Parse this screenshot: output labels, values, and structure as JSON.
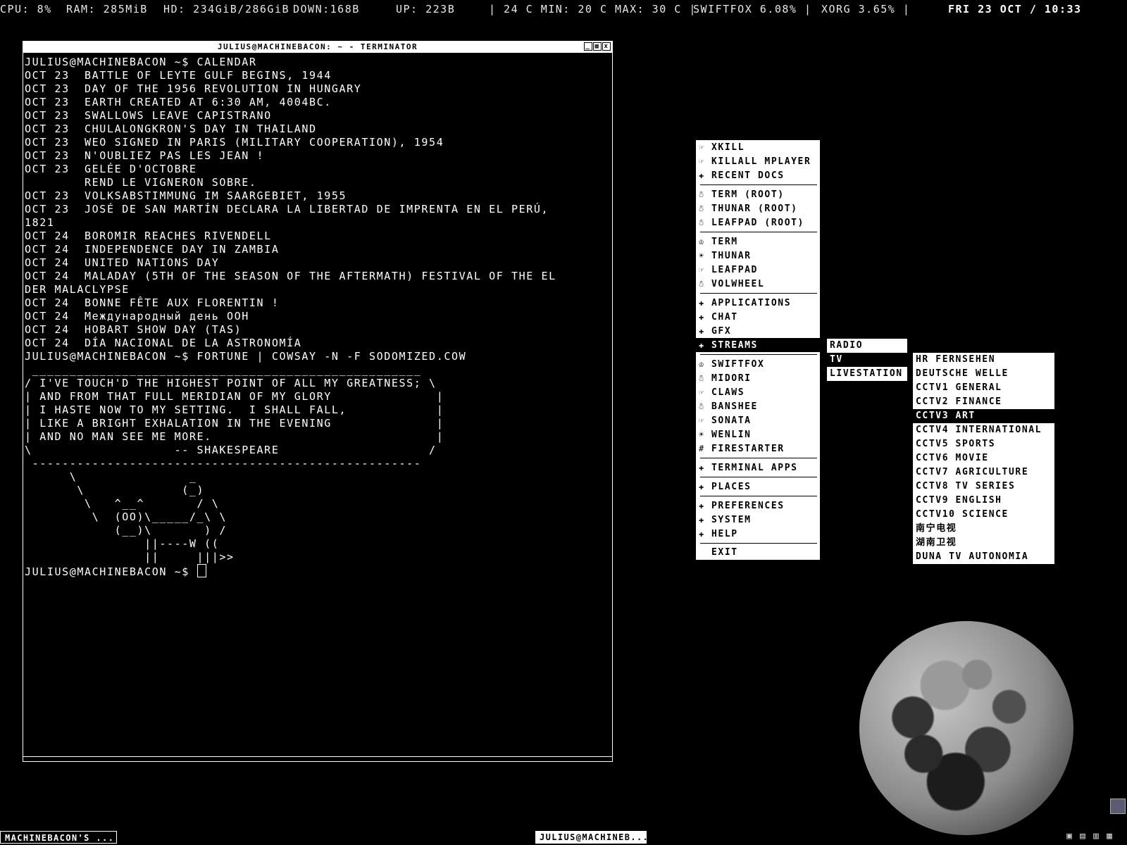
{
  "statusbar": {
    "cpu": "CPU: 8%",
    "ram": "RAM: 285MiB",
    "hd": "HD: 234GiB/286GiB",
    "down": "DOWN:168B",
    "up": "UP: 223B",
    "temp": "| 24 C MIN: 20 C MAX: 30 C |",
    "proc1": "SWIFTFOX  6.08% |",
    "proc2": "XORG      3.65% |",
    "clock": "FRI 23 OCT / 10:33"
  },
  "terminal": {
    "title": "JULIUS@MACHINEBACON: ~ - TERMINATOR",
    "buttons": [
      "_",
      "▦",
      "x"
    ],
    "lines": [
      "JULIUS@MACHINEBACON ~$ CALENDAR",
      "OCT 23  BATTLE OF LEYTE GULF BEGINS, 1944",
      "OCT 23  DAY OF THE 1956 REVOLUTION IN HUNGARY",
      "OCT 23  EARTH CREATED AT 6:30 AM, 4004BC.",
      "OCT 23  SWALLOWS LEAVE CAPISTRANO",
      "OCT 23  CHULALONGKRON'S DAY IN THAILAND",
      "OCT 23  WEO SIGNED IN PARIS (MILITARY COOPERATION), 1954",
      "OCT 23  N'OUBLIEZ PAS LES JEAN !",
      "OCT 23  GELÉE D'OCTOBRE",
      "        REND LE VIGNERON SOBRE.",
      "OCT 23  VOLKSABSTIMMUNG IM SAARGEBIET, 1955",
      "OCT 23  JOSÉ DE SAN MARTÍN DECLARA LA LIBERTAD DE IMPRENTA EN EL PERÚ,",
      "1821",
      "OCT 24  BOROMIR REACHES RIVENDELL",
      "OCT 24  INDEPENDENCE DAY IN ZAMBIA",
      "OCT 24  UNITED NATIONS DAY",
      "OCT 24  MALADAY (5TH OF THE SEASON OF THE AFTERMATH) FESTIVAL OF THE EL",
      "DER MALACLYPSE",
      "OCT 24  BONNE FÊTE AUX FLORENTIN !",
      "OCT 24  Международный день ООН",
      "OCT 24  HOBART SHOW DAY (TAS)",
      "OCT 24  DÍA NACIONAL DE LA ASTRONOMÍA",
      "JULIUS@MACHINEBACON ~$ FORTUNE | COWSAY -N -F SODOMIZED.COW",
      " ____________________________________________________",
      "/ I'VE TOUCH'D THE HIGHEST POINT OF ALL MY GREATNESS; \\",
      "| AND FROM THAT FULL MERIDIAN OF MY GLORY              |",
      "| I HASTE NOW TO MY SETTING.  I SHALL FALL,            |",
      "| LIKE A BRIGHT EXHALATION IN THE EVENING              |",
      "| AND NO MAN SEE ME MORE.                              |",
      "\\                   -- SHAKESPEARE                    /",
      " ----------------------------------------------------",
      "      \\               _",
      "       \\             (_)",
      "        \\   ^__^       / \\",
      "         \\  (OO)\\_____/_\\ \\",
      "            (__)\\       ) /",
      "                ||----W ((",
      "                ||     |||>>"
    ],
    "prompt": "JULIUS@MACHINEBACON ~$ "
  },
  "menu_main": [
    {
      "type": "item",
      "icon": "☞",
      "icon_name": "hand-icon",
      "label": "XKILL",
      "name": "menu-xkill"
    },
    {
      "type": "item",
      "icon": "☞",
      "icon_name": "hand-icon",
      "label": "KILLALL MPLAYER",
      "name": "menu-killall-mplayer"
    },
    {
      "type": "item",
      "icon": "✚",
      "icon_name": "plus-icon",
      "label": "RECENT DOCS",
      "name": "menu-recent-docs"
    },
    {
      "type": "sep"
    },
    {
      "type": "item",
      "icon": "☃",
      "icon_name": "snowman-icon",
      "label": "TERM (ROOT)",
      "name": "menu-term-root"
    },
    {
      "type": "item",
      "icon": "☃",
      "icon_name": "snowman-icon",
      "label": "THUNAR (ROOT)",
      "name": "menu-thunar-root"
    },
    {
      "type": "item",
      "icon": "☃",
      "icon_name": "snowman-icon",
      "label": "LEAFPAD (ROOT)",
      "name": "menu-leafpad-root"
    },
    {
      "type": "sep"
    },
    {
      "type": "item",
      "icon": "♔",
      "icon_name": "crown-icon",
      "label": "TERM",
      "name": "menu-term"
    },
    {
      "type": "item",
      "icon": "☀",
      "icon_name": "sun-icon",
      "label": "THUNAR",
      "name": "menu-thunar"
    },
    {
      "type": "item",
      "icon": "☞",
      "icon_name": "hand-icon",
      "label": "LEAFPAD",
      "name": "menu-leafpad"
    },
    {
      "type": "item",
      "icon": "☃",
      "icon_name": "snowman-icon",
      "label": "VOLWHEEL",
      "name": "menu-volwheel"
    },
    {
      "type": "sep"
    },
    {
      "type": "item",
      "icon": "✚",
      "icon_name": "plus-icon",
      "label": "APPLICATIONS",
      "name": "menu-applications"
    },
    {
      "type": "item",
      "icon": "✚",
      "icon_name": "plus-icon",
      "label": "CHAT",
      "name": "menu-chat"
    },
    {
      "type": "item",
      "icon": "✚",
      "icon_name": "plus-icon",
      "label": "GFX",
      "name": "menu-gfx"
    },
    {
      "type": "item",
      "icon": "✚",
      "icon_name": "plus-icon",
      "label": "STREAMS",
      "name": "menu-streams",
      "selected": true
    },
    {
      "type": "sep"
    },
    {
      "type": "item",
      "icon": "♔",
      "icon_name": "crown-icon",
      "label": "SWIFTFOX",
      "name": "menu-swiftfox"
    },
    {
      "type": "item",
      "icon": "☃",
      "icon_name": "snowman-icon",
      "label": "MIDORI",
      "name": "menu-midori"
    },
    {
      "type": "item",
      "icon": "☞",
      "icon_name": "hand-icon",
      "label": "CLAWS",
      "name": "menu-claws"
    },
    {
      "type": "item",
      "icon": "☃",
      "icon_name": "snowman-icon",
      "label": "BANSHEE",
      "name": "menu-banshee"
    },
    {
      "type": "item",
      "icon": "☞",
      "icon_name": "hand-icon",
      "label": "SONATA",
      "name": "menu-sonata"
    },
    {
      "type": "item",
      "icon": "☀",
      "icon_name": "sun-icon",
      "label": "WENLIN",
      "name": "menu-wenlin"
    },
    {
      "type": "item",
      "icon": "#",
      "icon_name": "hash-icon",
      "label": "FIRESTARTER",
      "name": "menu-firestarter"
    },
    {
      "type": "sep"
    },
    {
      "type": "item",
      "icon": "✚",
      "icon_name": "plus-icon",
      "label": "TERMINAL APPS",
      "name": "menu-terminal-apps"
    },
    {
      "type": "sep"
    },
    {
      "type": "item",
      "icon": "✚",
      "icon_name": "plus-icon",
      "label": "PLACES",
      "name": "menu-places"
    },
    {
      "type": "sep"
    },
    {
      "type": "item",
      "icon": "✚",
      "icon_name": "plus-icon",
      "label": "PREFERENCES",
      "name": "menu-preferences"
    },
    {
      "type": "item",
      "icon": "✚",
      "icon_name": "plus-icon",
      "label": "SYSTEM",
      "name": "menu-system"
    },
    {
      "type": "item",
      "icon": "✚",
      "icon_name": "plus-icon",
      "label": "HELP",
      "name": "menu-help"
    },
    {
      "type": "sep"
    },
    {
      "type": "item",
      "icon": "",
      "icon_name": "",
      "label": "EXIT",
      "name": "menu-exit"
    }
  ],
  "menu_streams": [
    {
      "label": "RADIO",
      "name": "streams-radio"
    },
    {
      "label": "TV",
      "name": "streams-tv",
      "selected": true
    },
    {
      "label": "LIVESTATION",
      "name": "streams-livestation"
    }
  ],
  "menu_tv": [
    {
      "label": "HR FERNSEHEN",
      "name": "tv-hr-fernsehen"
    },
    {
      "label": "DEUTSCHE WELLE",
      "name": "tv-deutsche-welle"
    },
    {
      "label": "CCTV1 GENERAL",
      "name": "tv-cctv1"
    },
    {
      "label": "CCTV2 FINANCE",
      "name": "tv-cctv2"
    },
    {
      "label": "CCTV3 ART",
      "name": "tv-cctv3",
      "selected": true
    },
    {
      "label": "CCTV4 INTERNATIONAL",
      "name": "tv-cctv4"
    },
    {
      "label": "CCTV5 SPORTS",
      "name": "tv-cctv5"
    },
    {
      "label": "CCTV6 MOVIE",
      "name": "tv-cctv6"
    },
    {
      "label": "CCTV7 AGRICULTURE",
      "name": "tv-cctv7"
    },
    {
      "label": "CCTV8 TV SERIES",
      "name": "tv-cctv8"
    },
    {
      "label": "CCTV9 ENGLISH",
      "name": "tv-cctv9"
    },
    {
      "label": "CCTV10 SCIENCE",
      "name": "tv-cctv10"
    },
    {
      "label": "南宁电视",
      "name": "tv-nanning"
    },
    {
      "label": "湖南卫视",
      "name": "tv-hunan"
    },
    {
      "label": "DUNA TV AUTONOMIA",
      "name": "tv-duna-autonomia"
    }
  ],
  "taskbar": {
    "left": "MACHINEBACON'S ...",
    "mid": "JULIUS@MACHINEB...",
    "tray_icons": [
      "▣",
      "▤",
      "▥",
      "▦"
    ]
  }
}
